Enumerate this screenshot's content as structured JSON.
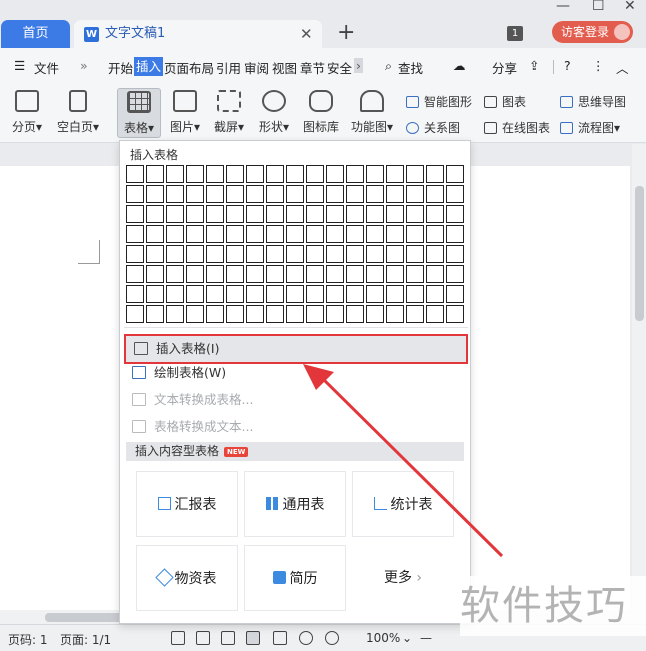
{
  "titlebar": {
    "home_tab": "首页",
    "doc_tab": "文字文稿1",
    "doc_icon": "W",
    "new_tab": "+",
    "window_count": "1",
    "guest_login": "访客登录"
  },
  "menubar": {
    "file": "文件",
    "tabs": [
      "开始",
      "插入",
      "页面布局",
      "引用",
      "审阅",
      "视图",
      "章节",
      "安全"
    ],
    "active_tab": "插入",
    "search": "查找",
    "share": "分享"
  },
  "ribbon": {
    "page_break": "分页",
    "blank_page": "空白页",
    "table": "表格",
    "picture": "图片",
    "screenshot": "截屏",
    "shape": "形状",
    "icon_library": "图标库",
    "function_chart": "功能图",
    "smart_graphic": "智能图形",
    "chart": "图表",
    "mind_map": "思维导图",
    "relation_chart": "关系图",
    "online_chart": "在线图表",
    "flow_chart": "流程图"
  },
  "dropdown": {
    "header": "插入表格",
    "grid_cols": 17,
    "grid_rows": 8,
    "items": [
      {
        "label": "插入表格(I)",
        "disabled": false
      },
      {
        "label": "绘制表格(W)",
        "disabled": false
      },
      {
        "label": "文本转换成表格...",
        "disabled": true
      },
      {
        "label": "表格转换成文本...",
        "disabled": true
      }
    ],
    "section_title": "插入内容型表格",
    "new_badge": "NEW",
    "cards": [
      "汇报表",
      "通用表",
      "统计表",
      "物资表",
      "简历"
    ],
    "more": "更多"
  },
  "statusbar": {
    "page_num": "页码: 1",
    "pages": "页面: 1/1",
    "zoom": "100%"
  },
  "watermark": "软件技巧",
  "colors": {
    "accent": "#3c7ae6",
    "highlight_border": "#e2363a",
    "arrow": "#e2363a",
    "login_button": "#e35d4e"
  }
}
